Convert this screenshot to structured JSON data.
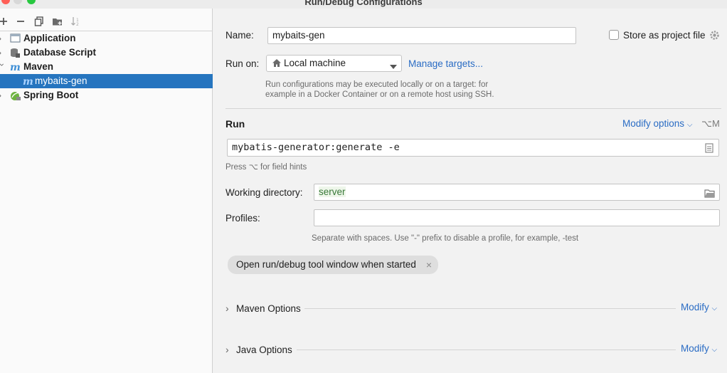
{
  "window": {
    "title": "Run/Debug Configurations"
  },
  "toolbar": {
    "add_icon": "plus-icon",
    "remove_icon": "minus-icon",
    "copy_icon": "copy-icon",
    "folder_icon": "new-folder-icon",
    "sort_icon": "sort-icon"
  },
  "tree": {
    "items": [
      {
        "label": "Application",
        "icon": "application-icon",
        "expanded": false
      },
      {
        "label": "Database Script",
        "icon": "database-script-icon",
        "expanded": false
      },
      {
        "label": "Maven",
        "icon": "maven-icon",
        "expanded": true
      },
      {
        "label": "mybaits-gen",
        "icon": "maven-icon",
        "selected": true
      },
      {
        "label": "Spring Boot",
        "icon": "spring-boot-icon",
        "expanded": false
      }
    ]
  },
  "form": {
    "name_label": "Name:",
    "name_value": "mybaits-gen",
    "store_label": "Store as project file",
    "store_checked": false,
    "run_on_label": "Run on:",
    "run_on_value": "Local machine",
    "manage_targets": "Manage targets...",
    "run_on_hint_1": "Run configurations may be executed locally or on a target: for",
    "run_on_hint_2": "example in a Docker Container or on a remote host using SSH.",
    "run_section": "Run",
    "modify_options": "Modify options",
    "modify_shortcut": "⌥M",
    "command_value": "mybatis-generator:generate -e",
    "field_hint": "Press ⌥ for field hints",
    "working_dir_label": "Working directory:",
    "working_dir_value": "server",
    "profiles_label": "Profiles:",
    "profiles_value": "",
    "profiles_hint": "Separate with spaces. Use \"-\" prefix to disable a profile, for example, -test",
    "tool_window_chip": "Open run/debug tool window when started"
  },
  "sections": [
    {
      "label": "Maven Options",
      "action": "Modify"
    },
    {
      "label": "Java Options",
      "action": "Modify"
    }
  ],
  "colors": {
    "selection": "#2675bf",
    "link": "#2a6cc4",
    "maven_icon": "#3f8fd6",
    "spring_icon": "#6db33f"
  }
}
